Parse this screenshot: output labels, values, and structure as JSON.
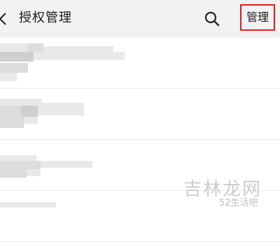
{
  "navbar": {
    "title": "授权管理",
    "manage_label": "管理",
    "icons": {
      "back": "chevron-left-icon",
      "search": "search-icon"
    },
    "accent": "#e02020"
  },
  "list": {
    "items_count_visible": 4,
    "content": "pixelated / blurred"
  },
  "watermark": {
    "brand": "吉林龙网",
    "site": "52生活吧"
  }
}
